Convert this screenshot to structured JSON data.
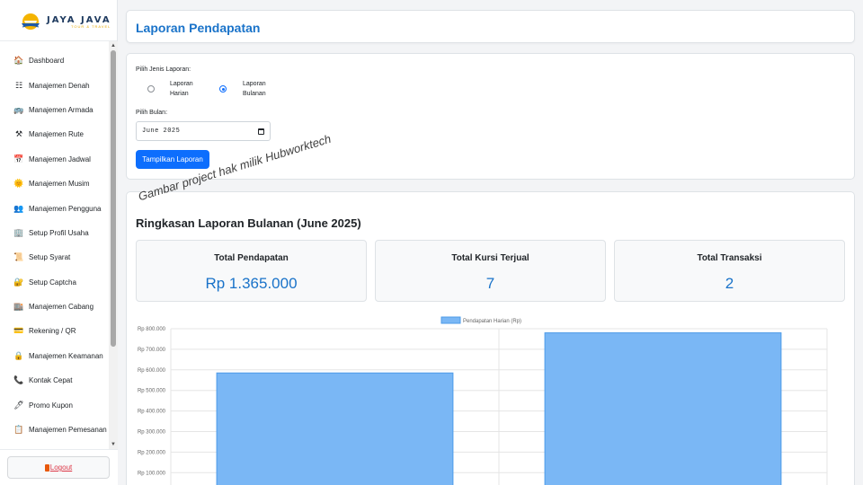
{
  "brand": {
    "name": "JAYA JAVA",
    "tagline": "TOUR & TRAVEL"
  },
  "sidebar": {
    "items": [
      {
        "label": "Dashboard",
        "icon": "home-icon"
      },
      {
        "label": "Manajemen Denah",
        "icon": "layout-grid-icon"
      },
      {
        "label": "Manajemen Armada",
        "icon": "bus-icon"
      },
      {
        "label": "Manajemen Rute",
        "icon": "tools-icon"
      },
      {
        "label": "Manajemen Jadwal",
        "icon": "calendar-icon"
      },
      {
        "label": "Manajemen Musim",
        "icon": "sun-icon"
      },
      {
        "label": "Manajemen Pengguna",
        "icon": "users-icon"
      },
      {
        "label": "Setup Profil Usaha",
        "icon": "building-icon"
      },
      {
        "label": "Setup Syarat",
        "icon": "scroll-icon"
      },
      {
        "label": "Setup Captcha",
        "icon": "lock-icon"
      },
      {
        "label": "Manajemen Cabang",
        "icon": "office-icon"
      },
      {
        "label": "Rekening / QR",
        "icon": "card-icon"
      },
      {
        "label": "Manajemen Keamanan",
        "icon": "padlock-icon"
      },
      {
        "label": "Kontak Cepat",
        "icon": "phone-icon"
      },
      {
        "label": "Promo Kupon",
        "icon": "pen-icon"
      },
      {
        "label": "Manajemen Pemesanan",
        "icon": "clipboard-icon"
      }
    ],
    "logout_label": "Logout"
  },
  "header": {
    "title": "Laporan Pendapatan"
  },
  "form": {
    "report_type_label": "Pilih Jenis Laporan:",
    "options": [
      {
        "label_line1": "Laporan",
        "label_line2": "Harian",
        "checked": false
      },
      {
        "label_line1": "Laporan",
        "label_line2": "Bulanan",
        "checked": true
      }
    ],
    "month_label": "Pilih Bulan:",
    "month_value": "June 2025",
    "submit_label": "Tampilkan Laporan"
  },
  "watermark": "Gambar project hak milik Hubworktech",
  "summary": {
    "title": "Ringkasan Laporan Bulanan (June 2025)",
    "stats": [
      {
        "title": "Total Pendapatan",
        "value": "Rp 1.365.000"
      },
      {
        "title": "Total Kursi Terjual",
        "value": "7"
      },
      {
        "title": "Total Transaksi",
        "value": "2"
      }
    ]
  },
  "chart_data": {
    "type": "bar",
    "series": [
      {
        "name": "Pendapatan Harian (Rp)",
        "values": [
          585000,
          780000
        ],
        "color": "#7ab7f5"
      }
    ],
    "categories": [
      "",
      ""
    ],
    "ylim": [
      0,
      800000
    ],
    "yticks": [
      "Rp 100.000",
      "Rp 200.000",
      "Rp 300.000",
      "Rp 400.000",
      "Rp 500.000",
      "Rp 600.000",
      "Rp 700.000",
      "Rp 800.000"
    ],
    "legend": "top-center",
    "grid": true
  },
  "colors": {
    "accent": "#1a73c9",
    "primary_button": "#0d6efd",
    "logout": "#dc3545"
  }
}
